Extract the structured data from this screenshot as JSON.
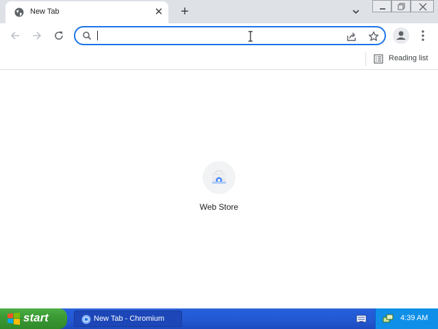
{
  "browser": {
    "tab": {
      "title": "New Tab",
      "close_label": "✕"
    },
    "new_tab_label": "+",
    "omnibox": {
      "value": "",
      "placeholder": ""
    },
    "bookmarks": {
      "reading_list_label": "Reading list"
    },
    "icons": [
      "globe-icon",
      "close-icon",
      "plus-icon",
      "chevron-down-icon",
      "minimize-icon",
      "restore-icon",
      "close-window-icon",
      "back-icon",
      "forward-icon",
      "reload-icon",
      "search-icon",
      "share-icon",
      "star-icon",
      "profile-icon",
      "kebab-menu-icon",
      "reading-list-icon"
    ]
  },
  "content": {
    "shortcuts": [
      {
        "label": "Web Store",
        "icon": "web-store-icon"
      }
    ]
  },
  "taskbar": {
    "start_label": "start",
    "task_label": "New Tab - Chromium",
    "clock": "4:39 AM"
  },
  "colors": {
    "accent": "#1a73e8",
    "tab_strip": "#dee1e6",
    "taskbar": "#245edb",
    "start": "#3c9a35"
  }
}
